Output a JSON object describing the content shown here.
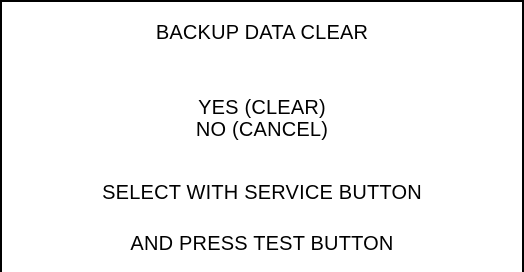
{
  "menu": {
    "title": "BACKUP DATA CLEAR",
    "options": [
      {
        "label": "YES (CLEAR)"
      },
      {
        "label": "NO (CANCEL)"
      }
    ],
    "instructions": [
      "SELECT WITH SERVICE BUTTON",
      "AND PRESS TEST BUTTON"
    ]
  }
}
